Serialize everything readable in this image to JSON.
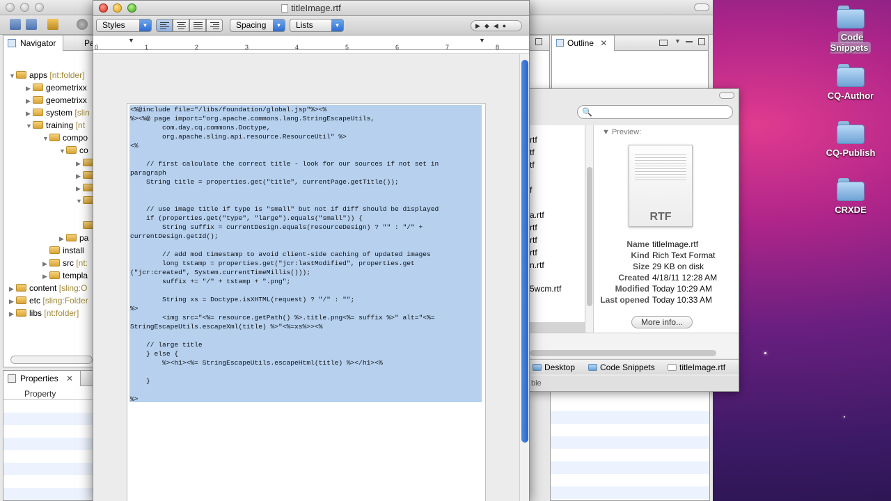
{
  "desktop": {
    "icons": [
      {
        "label": "Code Snippets"
      },
      {
        "label": "CQ-Author"
      },
      {
        "label": "CQ-Publish"
      },
      {
        "label": "CRXDE"
      }
    ]
  },
  "eclipse": {
    "navigator_tab": "Navigator",
    "second_tab": "Pa",
    "outline_tab": "Outline",
    "properties_tab": "Properties",
    "properties_column": "Property",
    "tree": [
      {
        "name": "apps",
        "meta": "[nt:folder]"
      },
      {
        "name": "geometrixx",
        "meta": ""
      },
      {
        "name": "geometrixx",
        "meta": ""
      },
      {
        "name": "system",
        "meta": "[slin"
      },
      {
        "name": "training",
        "meta": "[nt"
      },
      {
        "name": "compo",
        "meta": ""
      },
      {
        "name": "co",
        "meta": ""
      },
      {
        "name": "pa",
        "meta": ""
      },
      {
        "name": "install",
        "meta": ""
      },
      {
        "name": "src",
        "meta": "[nt:"
      },
      {
        "name": "templa",
        "meta": ""
      },
      {
        "name": "content",
        "meta": "[sling:O"
      },
      {
        "name": "etc",
        "meta": "[sling:Folder"
      },
      {
        "name": "libs",
        "meta": "[nt:folder]"
      }
    ]
  },
  "rtf_window": {
    "title": "titleImage.rtf",
    "styles_label": "Styles",
    "spacing_label": "Spacing",
    "lists_label": "Lists",
    "ruler_numbers": [
      "0",
      "1",
      "2",
      "3",
      "4",
      "5",
      "6",
      "7",
      "8"
    ],
    "code": "<%@include file=\"/libs/foundation/global.jsp\"%><%\n%><%@ page import=\"org.apache.commons.lang.StringEscapeUtils,\n        com.day.cq.commons.Doctype,\n        org.apache.sling.api.resource.ResourceUtil\" %>\n<%\n\n    // first calculate the correct title - look for our sources if not set in\nparagraph\n    String title = properties.get(\"title\", currentPage.getTitle());\n\n\n    // use image title if type is \"small\" but not if diff should be displayed\n    if (properties.get(\"type\", \"large\").equals(\"small\")) {\n        String suffix = currentDesign.equals(resourceDesign) ? \"\" : \"/\" +\ncurrentDesign.getId();\n\n        // add mod timestamp to avoid client-side caching of updated images\n        long tstamp = properties.get(\"jcr:lastModified\", properties.get\n(\"jcr:created\", System.currentTimeMillis()));\n        suffix += \"/\" + tstamp + \".png\";\n\n        String xs = Doctype.isXHTML(request) ? \"/\" : \"\";\n%>\n        <img src=\"<%= resource.getPath() %>.title.png<%= suffix %>\" alt=\"<%=\nStringEscapeUtils.escapeXml(title) %>\"<%=xs%>><%\n\n    // large title\n    } else {\n        %><h1><%= StringEscapeUtils.escapeHtml(title) %></h1><%\n\n    }\n\n%>"
  },
  "finder": {
    "partial_files": [
      "rtf",
      "tf",
      "tf",
      "f",
      "a.rtf",
      "rtf",
      "rtf",
      "rtf",
      "n.rtf",
      "5wcm.rtf"
    ],
    "preview_label": "Preview:",
    "thumb_text": "RTF",
    "info": [
      {
        "key": "Name",
        "value": "titleImage.rtf"
      },
      {
        "key": "Kind",
        "value": "Rich Text Format"
      },
      {
        "key": "Size",
        "value": "29 KB on disk"
      },
      {
        "key": "Created",
        "value": "4/18/11 12:28 AM"
      },
      {
        "key": "Modified",
        "value": "Today 10:29 AM"
      },
      {
        "key": "Last opened",
        "value": "Today 10:33 AM"
      }
    ],
    "more_info": "More info...",
    "path": [
      "Desktop",
      "Code Snippets",
      "titleImage.rtf"
    ],
    "status_partial": "ble"
  }
}
